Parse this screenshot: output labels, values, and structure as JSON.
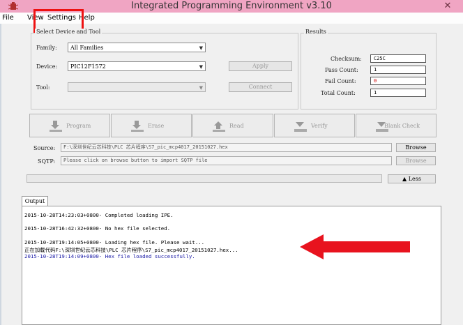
{
  "window": {
    "title": "Integrated Programming Environment v3.10",
    "icon": "bug-icon",
    "close_glyph": "✕"
  },
  "menu": {
    "items": [
      "File",
      "View",
      "Settings",
      "Help"
    ],
    "highlighted": "Settings",
    "highlight_color": "#ee1111"
  },
  "device_tool": {
    "group_title": "Select Device and Tool",
    "family_label": "Family:",
    "family_value": "All Families",
    "device_label": "Device:",
    "device_value": "PIC12F1572",
    "tool_label": "Tool:",
    "tool_value": "",
    "apply_label": "Apply",
    "connect_label": "Connect"
  },
  "results": {
    "group_title": "Results",
    "checksum_label": "Checksum:",
    "checksum_value": "C25C",
    "pass_label": "Pass Count:",
    "pass_value": "1",
    "fail_label": "Fail Count:",
    "fail_value": "0",
    "total_label": "Total Count:",
    "total_value": "1",
    "fail_color": "#cc0000"
  },
  "actions": [
    "Program",
    "Erase",
    "Read",
    "Verify",
    "Blank Check"
  ],
  "source": {
    "source_label": "Source:",
    "source_value": "F:\\深圳世纪云芯科技\\PLC 芯片程序\\S7_pic_mcp4017_20151027.hex",
    "browse_label": "Browse",
    "sqtp_label": "SQTP:",
    "sqtp_value": "Please click on browse button to import SQTP file",
    "browse2_label": "Browse"
  },
  "less_label": "Less",
  "output": {
    "tab_label": "Output",
    "lines": [
      {
        "text": "2015-10-28T14:23:03+0800- Completed loading IPE.",
        "color": "#000000"
      },
      {
        "text": "2015-10-28T16:42:32+0800- No hex file selected.",
        "color": "#000000"
      },
      {
        "text": "2015-10-28T19:14:05+0800- Loading hex file. Please wait...",
        "color": "#000000"
      },
      {
        "text": "正在加载代码F:\\深圳世纪云芯科技\\PLC 芯片程序\\S7_pic_mcp4017_20151027.hex...",
        "color": "#000000"
      },
      {
        "text": "2015-10-28T19:14:09+0800- Hex file loaded successfully.",
        "color": "#1a1aa6"
      }
    ],
    "arrow_color": "#e8131e"
  }
}
